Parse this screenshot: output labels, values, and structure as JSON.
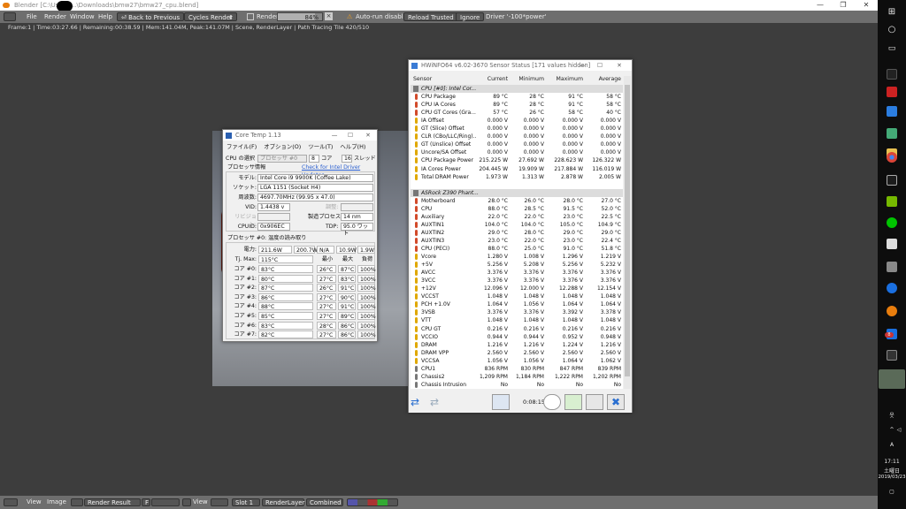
{
  "blender": {
    "title": "Blender [C:\\Users\\...\\Downloads\\bmw27\\bmw27_cpu.blend]",
    "menu": [
      "File",
      "Render",
      "Window",
      "Help"
    ],
    "back_button": "Back to Previous",
    "engine": "Cycles Render",
    "render_label": "Render",
    "progress_text": "84%",
    "progress": 0.84,
    "autorun": "Auto-run disabled",
    "reload": "Reload Trusted",
    "ignore": "Ignore",
    "driver": "Driver '-100*power'",
    "info": "Frame:1 | Time:03:27.66 | Remaining:00:38.59 | Mem:141.04M, Peak:141.07M | Scene, RenderLayer | Path Tracing Tile 420/510",
    "bottom": {
      "view": "View",
      "image": "Image",
      "render_result": "Render Result",
      "f": "F",
      "view2": "View",
      "slot": "Slot 1",
      "layer": "RenderLayer",
      "pass": "Combined"
    }
  },
  "coretemp": {
    "title": "Core Temp 1.13",
    "menu": [
      "ファイル(F)",
      "オプション(O)",
      "ツール(T)",
      "ヘルプ(H)"
    ],
    "cpu_select_label": "CPU の選択",
    "cpu_select_value": "プロセッサ #0",
    "cores": "8",
    "cores_label": "コア",
    "threads": "16",
    "threads_label": "スレッド",
    "info_header": "プロセッサ情報",
    "driver_link": "Check for Intel Driver Updates",
    "model_label": "モデル:",
    "model": "Intel Core i9 9900K (Coffee Lake)",
    "socket_label": "ソケット:",
    "socket": "LGA 1151 (Socket H4)",
    "freq_label": "周波数:",
    "freq": "4697.70MHz (99.95 x 47.0)",
    "vid_label": "VID:",
    "vid": "1.4438 v",
    "adjust_label": "調整:",
    "revision_label": "リビジョン:",
    "process_label": "製造プロセス:",
    "process": "14 nm",
    "cpuid_label": "CPUID:",
    "cpuid": "0x906EC",
    "tdp_label": "TDP:",
    "tdp": "95.0 ワット",
    "temp_header": "プロセッサ #0: 温度の読み取り",
    "power_label": "電力:",
    "power": [
      "211.6W",
      "200.7W",
      "N/A",
      "10.9W",
      "1.9W"
    ],
    "tjmax_label": "Tj. Max:",
    "tjmax": "115°C",
    "col_min": "最小",
    "col_max": "最大",
    "col_load": "負荷",
    "cores_rows": [
      {
        "label": "コア #0:",
        "temp": "83°C",
        "min": "26°C",
        "max": "87°C",
        "load": "100%"
      },
      {
        "label": "コア #1:",
        "temp": "80°C",
        "min": "27°C",
        "max": "83°C",
        "load": "100%"
      },
      {
        "label": "コア #2:",
        "temp": "87°C",
        "min": "26°C",
        "max": "91°C",
        "load": "100%"
      },
      {
        "label": "コア #3:",
        "temp": "86°C",
        "min": "27°C",
        "max": "90°C",
        "load": "100%"
      },
      {
        "label": "コア #4:",
        "temp": "88°C",
        "min": "27°C",
        "max": "91°C",
        "load": "100%"
      },
      {
        "label": "コア #5:",
        "temp": "85°C",
        "min": "27°C",
        "max": "89°C",
        "load": "100%"
      },
      {
        "label": "コア #6:",
        "temp": "83°C",
        "min": "28°C",
        "max": "86°C",
        "load": "100%"
      },
      {
        "label": "コア #7:",
        "temp": "82°C",
        "min": "27°C",
        "max": "86°C",
        "load": "100%"
      }
    ]
  },
  "hwinfo": {
    "title": "HWiNFO64 v6.02-3670 Sensor Status [171 values hidden]",
    "headers": [
      "Sensor",
      "Current",
      "Minimum",
      "Maximum",
      "Average"
    ],
    "timer": "0:08:15",
    "rows": [
      {
        "group": true,
        "name": "CPU [#0]: Intel Cor..."
      },
      {
        "name": "CPU Package",
        "cur": "89 °C",
        "min": "28 °C",
        "max": "91 °C",
        "avg": "58 °C",
        "t": "temp"
      },
      {
        "name": "CPU IA Cores",
        "cur": "89 °C",
        "min": "28 °C",
        "max": "91 °C",
        "avg": "58 °C",
        "t": "temp"
      },
      {
        "name": "CPU GT Cores (Gra...",
        "cur": "57 °C",
        "min": "26 °C",
        "max": "58 °C",
        "avg": "40 °C",
        "t": "temp"
      },
      {
        "name": "IA Offset",
        "cur": "0.000 V",
        "min": "0.000 V",
        "max": "0.000 V",
        "avg": "0.000 V",
        "t": "volt"
      },
      {
        "name": "GT (Slice) Offset",
        "cur": "0.000 V",
        "min": "0.000 V",
        "max": "0.000 V",
        "avg": "0.000 V",
        "t": "volt"
      },
      {
        "name": "CLR (CBo/LLC/Ring)...",
        "cur": "0.000 V",
        "min": "0.000 V",
        "max": "0.000 V",
        "avg": "0.000 V",
        "t": "volt"
      },
      {
        "name": "GT (Unslice) Offset",
        "cur": "0.000 V",
        "min": "0.000 V",
        "max": "0.000 V",
        "avg": "0.000 V",
        "t": "volt"
      },
      {
        "name": "Uncore/SA Offset",
        "cur": "0.000 V",
        "min": "0.000 V",
        "max": "0.000 V",
        "avg": "0.000 V",
        "t": "volt"
      },
      {
        "name": "CPU Package Power",
        "cur": "215.225 W",
        "min": "27.692 W",
        "max": "228.623 W",
        "avg": "126.322 W",
        "t": "volt"
      },
      {
        "name": "IA Cores Power",
        "cur": "204.445 W",
        "min": "19.909 W",
        "max": "217.884 W",
        "avg": "116.019 W",
        "t": "volt"
      },
      {
        "name": "Total DRAM Power",
        "cur": "1.973 W",
        "min": "1.313 W",
        "max": "2.878 W",
        "avg": "2.005 W",
        "t": "volt"
      },
      {
        "spacer": true
      },
      {
        "group": true,
        "name": "ASRock Z390 Phant..."
      },
      {
        "name": "Motherboard",
        "cur": "28.0 °C",
        "min": "26.0 °C",
        "max": "28.0 °C",
        "avg": "27.0 °C",
        "t": "temp"
      },
      {
        "name": "CPU",
        "cur": "88.0 °C",
        "min": "28.5 °C",
        "max": "91.5 °C",
        "avg": "52.0 °C",
        "t": "temp"
      },
      {
        "name": "Auxiliary",
        "cur": "22.0 °C",
        "min": "22.0 °C",
        "max": "23.0 °C",
        "avg": "22.5 °C",
        "t": "temp"
      },
      {
        "name": "AUXTIN1",
        "cur": "104.0 °C",
        "min": "104.0 °C",
        "max": "105.0 °C",
        "avg": "104.9 °C",
        "t": "temp"
      },
      {
        "name": "AUXTIN2",
        "cur": "29.0 °C",
        "min": "28.0 °C",
        "max": "29.0 °C",
        "avg": "29.0 °C",
        "t": "temp"
      },
      {
        "name": "AUXTIN3",
        "cur": "23.0 °C",
        "min": "22.0 °C",
        "max": "23.0 °C",
        "avg": "22.4 °C",
        "t": "temp"
      },
      {
        "name": "CPU (PECI)",
        "cur": "88.0 °C",
        "min": "25.0 °C",
        "max": "91.0 °C",
        "avg": "51.8 °C",
        "t": "temp"
      },
      {
        "name": "Vcore",
        "cur": "1.280 V",
        "min": "1.008 V",
        "max": "1.296 V",
        "avg": "1.219 V",
        "t": "volt"
      },
      {
        "name": "+5V",
        "cur": "5.256 V",
        "min": "5.208 V",
        "max": "5.256 V",
        "avg": "5.232 V",
        "t": "volt"
      },
      {
        "name": "AVCC",
        "cur": "3.376 V",
        "min": "3.376 V",
        "max": "3.376 V",
        "avg": "3.376 V",
        "t": "volt"
      },
      {
        "name": "3VCC",
        "cur": "3.376 V",
        "min": "3.376 V",
        "max": "3.376 V",
        "avg": "3.376 V",
        "t": "volt"
      },
      {
        "name": "+12V",
        "cur": "12.096 V",
        "min": "12.000 V",
        "max": "12.288 V",
        "avg": "12.154 V",
        "t": "volt"
      },
      {
        "name": "VCCST",
        "cur": "1.048 V",
        "min": "1.048 V",
        "max": "1.048 V",
        "avg": "1.048 V",
        "t": "volt"
      },
      {
        "name": "PCH +1.0V",
        "cur": "1.064 V",
        "min": "1.056 V",
        "max": "1.064 V",
        "avg": "1.064 V",
        "t": "volt"
      },
      {
        "name": "3VSB",
        "cur": "3.376 V",
        "min": "3.376 V",
        "max": "3.392 V",
        "avg": "3.378 V",
        "t": "volt"
      },
      {
        "name": "VTT",
        "cur": "1.048 V",
        "min": "1.048 V",
        "max": "1.048 V",
        "avg": "1.048 V",
        "t": "volt"
      },
      {
        "name": "CPU GT",
        "cur": "0.216 V",
        "min": "0.216 V",
        "max": "0.216 V",
        "avg": "0.216 V",
        "t": "volt"
      },
      {
        "name": "VCCIO",
        "cur": "0.944 V",
        "min": "0.944 V",
        "max": "0.952 V",
        "avg": "0.948 V",
        "t": "volt"
      },
      {
        "name": "DRAM",
        "cur": "1.216 V",
        "min": "1.216 V",
        "max": "1.224 V",
        "avg": "1.216 V",
        "t": "volt"
      },
      {
        "name": "DRAM VPP",
        "cur": "2.560 V",
        "min": "2.560 V",
        "max": "2.560 V",
        "avg": "2.560 V",
        "t": "volt"
      },
      {
        "name": "VCCSA",
        "cur": "1.056 V",
        "min": "1.056 V",
        "max": "1.064 V",
        "avg": "1.062 V",
        "t": "volt"
      },
      {
        "name": "CPU1",
        "cur": "836 RPM",
        "min": "830 RPM",
        "max": "847 RPM",
        "avg": "839 RPM",
        "t": "fan"
      },
      {
        "name": "Chassis2",
        "cur": "1,209 RPM",
        "min": "1,184 RPM",
        "max": "1,222 RPM",
        "avg": "1,202 RPM",
        "t": "fan"
      },
      {
        "name": "Chassis Intrusion",
        "cur": "No",
        "min": "No",
        "max": "No",
        "avg": "No",
        "t": "fan"
      }
    ]
  },
  "taskbar": {
    "ime": "A",
    "time": "17:11",
    "day": "土曜日",
    "date": "2019/03/23",
    "badge": "8"
  }
}
